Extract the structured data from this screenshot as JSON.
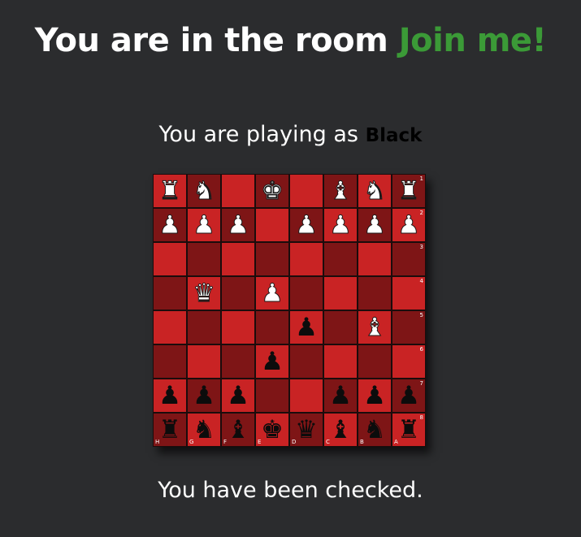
{
  "header": {
    "prefix": "You are in the room",
    "room_name": "Join me!",
    "room_color": "#3b9a37"
  },
  "player": {
    "prefix": "You are playing as",
    "color": "Black"
  },
  "status_text": "You have been checked.",
  "colors": {
    "background": "#2b2c2e",
    "light_square": "#c92324",
    "dark_square": "#7e1516"
  },
  "board": {
    "rank_labels": [
      "1",
      "2",
      "3",
      "4",
      "5",
      "6",
      "7",
      "8"
    ],
    "file_labels": [
      "H",
      "G",
      "F",
      "E",
      "D",
      "C",
      "B",
      "A"
    ],
    "rows": [
      [
        "wR",
        "wN",
        "",
        "wK",
        "",
        "wB",
        "wN",
        "wR"
      ],
      [
        "wP",
        "wP",
        "wP",
        "",
        "wP",
        "wP",
        "wP",
        "wP"
      ],
      [
        "",
        "",
        "",
        "",
        "",
        "",
        "",
        ""
      ],
      [
        "",
        "wQ",
        "",
        "wP",
        "",
        "",
        "",
        ""
      ],
      [
        "",
        "",
        "",
        "",
        "bP",
        "",
        "wB",
        ""
      ],
      [
        "",
        "",
        "",
        "bP",
        "",
        "",
        "",
        ""
      ],
      [
        "bP",
        "bP",
        "bP",
        "",
        "",
        "bP",
        "bP",
        "bP"
      ],
      [
        "bR",
        "bN",
        "bB",
        "bK",
        "bQ",
        "bB",
        "bN",
        "bR"
      ]
    ]
  }
}
